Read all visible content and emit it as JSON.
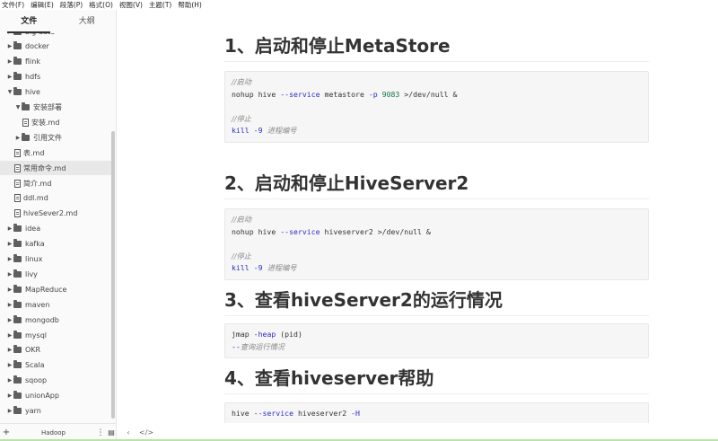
{
  "menu": [
    "文件(F)",
    "编辑(E)",
    "段落(P)",
    "格式(O)",
    "视图(V)",
    "主题(T)",
    "帮助(H)"
  ],
  "sidebar": {
    "tabs": {
      "files": "文件",
      "outline": "大纲"
    },
    "items": [
      {
        "label": "big data",
        "type": "folder",
        "depth": 0
      },
      {
        "label": "docker",
        "type": "folder",
        "depth": 0
      },
      {
        "label": "flink",
        "type": "folder",
        "depth": 0
      },
      {
        "label": "hdfs",
        "type": "folder",
        "depth": 0
      },
      {
        "label": "hive",
        "type": "folder",
        "depth": 0,
        "expanded": true
      },
      {
        "label": "安装部署",
        "type": "folder",
        "depth": 1,
        "expanded": true
      },
      {
        "label": "安装.md",
        "type": "file",
        "depth": 2
      },
      {
        "label": "引用文件",
        "type": "folder",
        "depth": 1
      },
      {
        "label": "表.md",
        "type": "file",
        "depth": 1
      },
      {
        "label": "常用命令.md",
        "type": "file",
        "depth": 1,
        "selected": true
      },
      {
        "label": "简介.md",
        "type": "file",
        "depth": 1
      },
      {
        "label": "ddl.md",
        "type": "file",
        "depth": 1
      },
      {
        "label": "hiveSever2.md",
        "type": "file",
        "depth": 1
      },
      {
        "label": "idea",
        "type": "folder",
        "depth": 0
      },
      {
        "label": "kafka",
        "type": "folder",
        "depth": 0
      },
      {
        "label": "linux",
        "type": "folder",
        "depth": 0
      },
      {
        "label": "livy",
        "type": "folder",
        "depth": 0
      },
      {
        "label": "MapReduce",
        "type": "folder",
        "depth": 0
      },
      {
        "label": "maven",
        "type": "folder",
        "depth": 0
      },
      {
        "label": "mongodb",
        "type": "folder",
        "depth": 0
      },
      {
        "label": "mysql",
        "type": "folder",
        "depth": 0
      },
      {
        "label": "OKR",
        "type": "folder",
        "depth": 0
      },
      {
        "label": "Scala",
        "type": "folder",
        "depth": 0
      },
      {
        "label": "sqoop",
        "type": "folder",
        "depth": 0
      },
      {
        "label": "unionApp",
        "type": "folder",
        "depth": 0
      },
      {
        "label": "yarn",
        "type": "folder",
        "depth": 0
      }
    ],
    "footer": {
      "add": "+",
      "workspace": "Hadoop",
      "more": "⋮",
      "outline": "▤"
    }
  },
  "editor_footer": {
    "back": "‹",
    "source": "</>"
  },
  "doc": {
    "h1": "1、启动和停止MetaStore",
    "h2": "2、启动和停止HiveServer2",
    "h3": "3、查看hiveServer2的运行情况",
    "h4": "4、查看hiveserver帮助",
    "c1": {
      "l1": "//启动",
      "l2a": "nohup hive ",
      "l2b": "--service",
      "l2c": " metastore ",
      "l2d": "-p",
      "l2e": " ",
      "l2f": "9083",
      "l2g": " >/dev/null &",
      "l4": "//停止",
      "l5a": "kill",
      "l5b": " -9",
      "l5c": "  进程编号"
    },
    "c2": {
      "l1": "//启动",
      "l2a": "nohup hive ",
      "l2b": "--service",
      "l2c": " hiveserver2 >/dev/null &",
      "l4": "//停止",
      "l5a": "kill",
      "l5b": " -9",
      "l5c": "  进程编号"
    },
    "c3": {
      "l1a": "jmap ",
      "l1b": "-heap",
      "l1c": " (pid)",
      "l2a": "--",
      "l2b": "查询运行情况"
    },
    "c4": {
      "l1a": "hive ",
      "l1b": "--service",
      "l1c": " hiveserver2 ",
      "l1d": "-H"
    }
  }
}
